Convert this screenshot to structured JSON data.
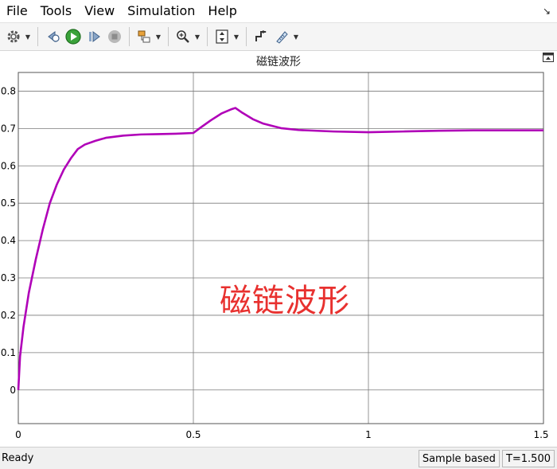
{
  "menu": [
    "File",
    "Tools",
    "View",
    "Simulation",
    "Help"
  ],
  "plot": {
    "title": "磁链波形",
    "annotation": "磁链波形",
    "line_color": "#b000b8"
  },
  "chart_data": {
    "type": "line",
    "title": "磁链波形",
    "xlabel": "",
    "ylabel": "",
    "xlim": [
      0,
      1.5
    ],
    "ylim": [
      -0.09,
      0.85
    ],
    "xticks": [
      0,
      0.5,
      1,
      1.5
    ],
    "xtick_labels": [
      "0",
      "0.5",
      "1",
      "1.5"
    ],
    "yticks": [
      0,
      0.1,
      0.2,
      0.3,
      0.4,
      0.5,
      0.6,
      0.7,
      0.8
    ],
    "ytick_labels": [
      "0",
      "0.1",
      "0.2",
      "0.3",
      "0.4",
      "0.5",
      "0.6",
      "0.7",
      "0.8"
    ],
    "grid": true,
    "series": [
      {
        "x": [
          0,
          0.005,
          0.015,
          0.03,
          0.05,
          0.07,
          0.09,
          0.11,
          0.13,
          0.15,
          0.17,
          0.19,
          0.22,
          0.25,
          0.3,
          0.35,
          0.4,
          0.45,
          0.5,
          0.52,
          0.55,
          0.58,
          0.61,
          0.62,
          0.64,
          0.67,
          0.7,
          0.75,
          0.8,
          0.9,
          1.0,
          1.1,
          1.2,
          1.3,
          1.4,
          1.5
        ],
        "y": [
          0,
          0.09,
          0.17,
          0.26,
          0.35,
          0.43,
          0.5,
          0.55,
          0.59,
          0.62,
          0.645,
          0.657,
          0.667,
          0.675,
          0.681,
          0.684,
          0.685,
          0.686,
          0.688,
          0.702,
          0.722,
          0.74,
          0.752,
          0.755,
          0.742,
          0.725,
          0.713,
          0.701,
          0.696,
          0.692,
          0.69,
          0.692,
          0.694,
          0.695,
          0.695,
          0.695
        ]
      }
    ]
  },
  "status": {
    "ready": "Ready",
    "sample_mode": "Sample based",
    "time": "T=1.500"
  }
}
